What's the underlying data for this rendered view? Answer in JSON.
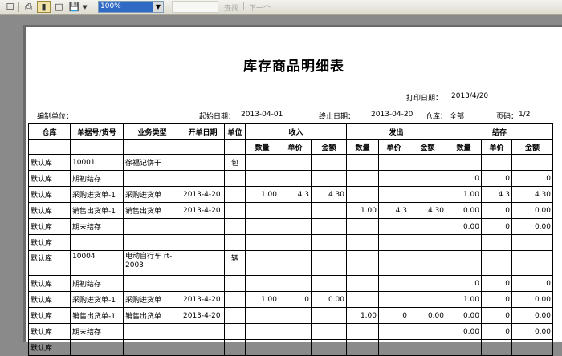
{
  "toolbar": {
    "zoom_value": "100%",
    "find_label": "查找",
    "next_label": "下一个",
    "separator": "|"
  },
  "report": {
    "title": "库存商品明细表",
    "print_date_label": "打印日期：",
    "print_date": "2013/4/20",
    "compiler_label": "编制单位：",
    "start_label": "起始日期：",
    "start_date": "2013-04-01",
    "end_label": "终止日期：",
    "end_date": "2013-04-20",
    "warehouse_label": "仓库：",
    "warehouse": "全部",
    "page_label": "页码：",
    "page": "1/2"
  },
  "headers": {
    "warehouse": "仓库",
    "doc_no": "单据号/货号",
    "biz_type": "业务类型",
    "doc_date": "开单日期",
    "unit": "单位",
    "income": "收入",
    "outgo": "发出",
    "balance": "结存",
    "qty": "数量",
    "price": "单价",
    "amount": "金额"
  },
  "rows": [
    {
      "wh": "默认库",
      "doc": "10001",
      "type": "徐福记饼干",
      "date": "",
      "unit": "包",
      "iq": "",
      "ip": "",
      "ia": "",
      "oq": "",
      "op": "",
      "oa": "",
      "bq": "",
      "bp": "",
      "ba": ""
    },
    {
      "wh": "默认库",
      "doc": "期初结存",
      "type": "",
      "date": "",
      "unit": "",
      "iq": "",
      "ip": "",
      "ia": "",
      "oq": "",
      "op": "",
      "oa": "",
      "bq": "0",
      "bp": "0",
      "ba": "0"
    },
    {
      "wh": "默认库",
      "doc": "采购进货单-1",
      "type": "采购进货单",
      "date": "2013-4-20",
      "unit": "",
      "iq": "1.00",
      "ip": "4.3",
      "ia": "4.30",
      "oq": "",
      "op": "",
      "oa": "",
      "bq": "1.00",
      "bp": "4.3",
      "ba": "4.30"
    },
    {
      "wh": "默认库",
      "doc": "销售出货单-1",
      "type": "销售出货单",
      "date": "2013-4-20",
      "unit": "",
      "iq": "",
      "ip": "",
      "ia": "",
      "oq": "1.00",
      "op": "4.3",
      "oa": "4.30",
      "bq": "0.00",
      "bp": "0",
      "ba": "0.00"
    },
    {
      "wh": "默认库",
      "doc": "期末结存",
      "type": "",
      "date": "",
      "unit": "",
      "iq": "",
      "ip": "",
      "ia": "",
      "oq": "",
      "op": "",
      "oa": "",
      "bq": "0.00",
      "bp": "0",
      "ba": "0.00"
    },
    {
      "wh": "默认库",
      "doc": "",
      "type": "",
      "date": "",
      "unit": "",
      "iq": "",
      "ip": "",
      "ia": "",
      "oq": "",
      "op": "",
      "oa": "",
      "bq": "",
      "bp": "",
      "ba": ""
    },
    {
      "wh": "默认库",
      "doc": "10004",
      "type": "电动自行车 rt-2003",
      "date": "",
      "unit": "辆",
      "iq": "",
      "ip": "",
      "ia": "",
      "oq": "",
      "op": "",
      "oa": "",
      "bq": "",
      "bp": "",
      "ba": ""
    },
    {
      "wh": "默认库",
      "doc": "期初结存",
      "type": "",
      "date": "",
      "unit": "",
      "iq": "",
      "ip": "",
      "ia": "",
      "oq": "",
      "op": "",
      "oa": "",
      "bq": "0",
      "bp": "0",
      "ba": "0"
    },
    {
      "wh": "默认库",
      "doc": "采购进货单-1",
      "type": "采购进货单",
      "date": "2013-4-20",
      "unit": "",
      "iq": "1.00",
      "ip": "0",
      "ia": "0.00",
      "oq": "",
      "op": "",
      "oa": "",
      "bq": "1.00",
      "bp": "0",
      "ba": "0.00"
    },
    {
      "wh": "默认库",
      "doc": "销售出货单-1",
      "type": "销售出货单",
      "date": "2013-4-20",
      "unit": "",
      "iq": "",
      "ip": "",
      "ia": "",
      "oq": "1.00",
      "op": "0",
      "oa": "0.00",
      "bq": "0.00",
      "bp": "0",
      "ba": "0.00"
    },
    {
      "wh": "默认库",
      "doc": "期末结存",
      "type": "",
      "date": "",
      "unit": "",
      "iq": "",
      "ip": "",
      "ia": "",
      "oq": "",
      "op": "",
      "oa": "",
      "bq": "0.00",
      "bp": "0",
      "ba": "0.00"
    },
    {
      "wh": "默认库",
      "doc": "",
      "type": "",
      "date": "",
      "unit": "",
      "iq": "",
      "ip": "",
      "ia": "",
      "oq": "",
      "op": "",
      "oa": "",
      "bq": "",
      "bp": "",
      "ba": ""
    }
  ]
}
